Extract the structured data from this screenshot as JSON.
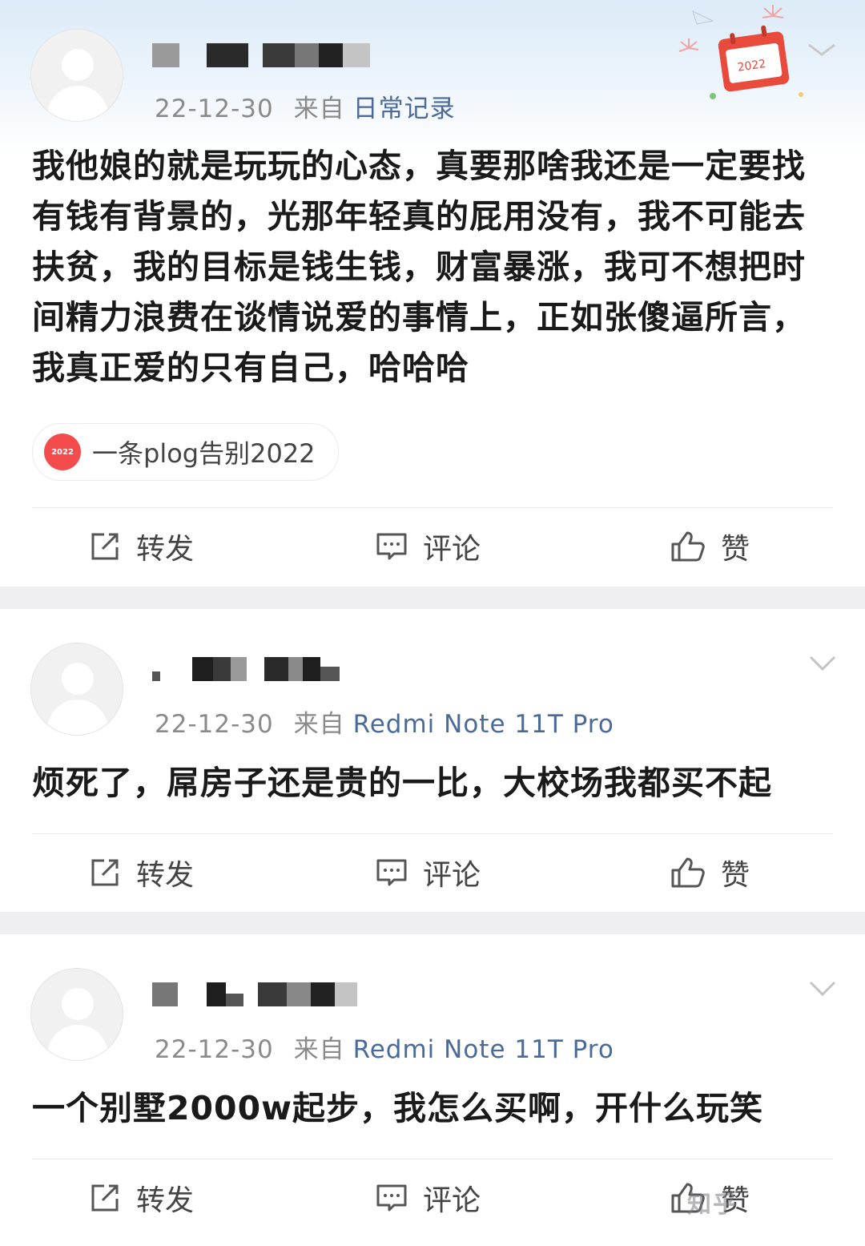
{
  "posts": [
    {
      "date": "22-12-30",
      "from_label": "来自",
      "source": "日常记录",
      "content": "我他娘的就是玩玩的心态，真要那啥我还是一定要找有钱有背景的，光那年轻真的屁用没有，我不可能去扶贫，我的目标是钱生钱，财富暴涨，我可不想把时间精力浪费在谈情说爱的事情上，正如张傻逼所言，我真正爱的只有自己，哈哈哈",
      "topic_icon_text": "2022",
      "topic": "一条plog告别2022",
      "actions": {
        "repost": "转发",
        "comment": "评论",
        "like": "赞"
      }
    },
    {
      "date": "22-12-30",
      "from_label": "来自",
      "source": "Redmi Note 11T Pro",
      "content": "烦死了，屌房子还是贵的一比，大校场我都买不起",
      "actions": {
        "repost": "转发",
        "comment": "评论",
        "like": "赞"
      }
    },
    {
      "date": "22-12-30",
      "from_label": "来自",
      "source": "Redmi Note 11T Pro",
      "content": "一个别墅2000w起步，我怎么买啊，开什么玩笑",
      "actions": {
        "repost": "转发",
        "comment": "评论",
        "like": "赞"
      }
    }
  ],
  "decoration": {
    "calendar_text": "2022"
  },
  "watermark": "知乎"
}
